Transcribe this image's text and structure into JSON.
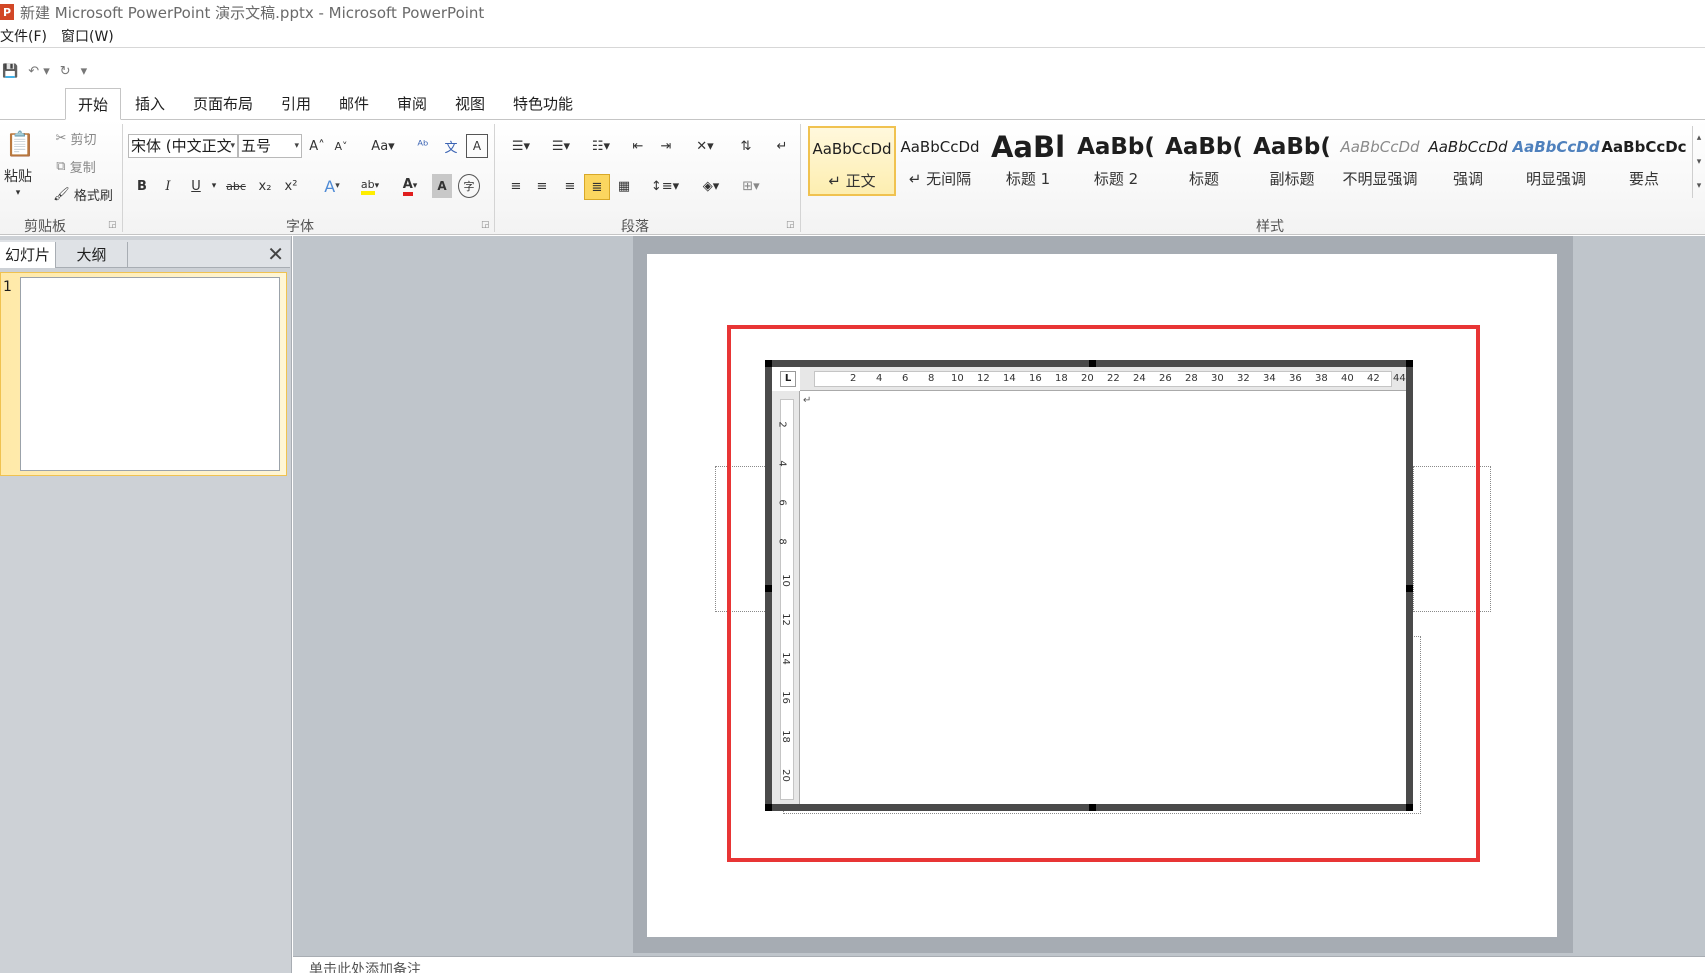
{
  "window": {
    "title": "新建 Microsoft PowerPoint 演示文稿.pptx - Microsoft PowerPoint",
    "app_icon": "P"
  },
  "menu": {
    "file": "文件(F)",
    "window": "窗口(W)"
  },
  "qat": {
    "save_icon": "save-icon",
    "undo_icon": "undo-icon",
    "redo_icon": "redo-icon",
    "customize_icon": "customize-icon"
  },
  "tabs": [
    "开始",
    "插入",
    "页面布局",
    "引用",
    "邮件",
    "审阅",
    "视图",
    "特色功能"
  ],
  "clipboard": {
    "paste": "粘贴",
    "cut": "剪切",
    "copy": "复制",
    "format_painter": "格式刷",
    "label": "剪贴板"
  },
  "font": {
    "name": "宋体 (中文正文",
    "size": "五号",
    "label": "字体",
    "buttons": [
      "B",
      "I",
      "U",
      "abc",
      "x₂",
      "x²",
      "A",
      "ab",
      "A",
      "A",
      "字"
    ]
  },
  "paragraph": {
    "label": "段落"
  },
  "styles": {
    "label": "样式",
    "items": [
      {
        "sample": "AaBbCcDd",
        "name": "↵ 正文"
      },
      {
        "sample": "AaBbCcDd",
        "name": "↵ 无间隔"
      },
      {
        "sample": "AaBl",
        "name": "标题 1"
      },
      {
        "sample": "AaBb(",
        "name": "标题 2"
      },
      {
        "sample": "AaBb(",
        "name": "标题"
      },
      {
        "sample": "AaBb(",
        "name": "副标题"
      },
      {
        "sample": "AaBbCcDd",
        "name": "不明显强调"
      },
      {
        "sample": "AaBbCcDd",
        "name": "强调"
      },
      {
        "sample": "AaBbCcDd",
        "name": "明显强调"
      },
      {
        "sample": "AaBbCcDc",
        "name": "要点"
      }
    ]
  },
  "pane": {
    "tab_slides": "幻灯片",
    "tab_outline": "大纲",
    "slide_number": "1"
  },
  "ruler": {
    "h_ticks": [
      "2",
      "4",
      "6",
      "8",
      "10",
      "12",
      "14",
      "16",
      "18",
      "20",
      "22",
      "24",
      "26",
      "28",
      "30",
      "32",
      "34",
      "36",
      "38",
      "40",
      "42",
      "44"
    ],
    "v_ticks": [
      "2",
      "4",
      "6",
      "8",
      "10",
      "12",
      "14",
      "16",
      "18",
      "20"
    ],
    "corner": "L"
  },
  "notes": {
    "placeholder": "单击此处添加备注"
  },
  "colors": {
    "accent_red": "#e83535",
    "selected_style": "#f0c250"
  }
}
